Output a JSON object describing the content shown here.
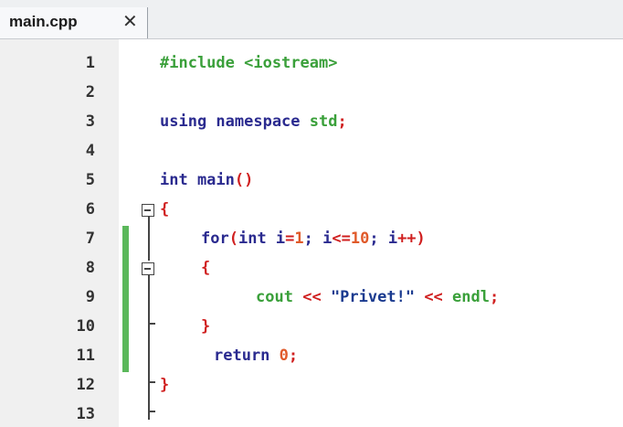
{
  "tab": {
    "filename": "main.cpp",
    "close_symbol": "✕"
  },
  "line_numbers": [
    "1",
    "2",
    "3",
    "4",
    "5",
    "6",
    "7",
    "8",
    "9",
    "10",
    "11",
    "12",
    "13"
  ],
  "code": {
    "l1_include": "#include <iostream>",
    "l3_using": "using namespace",
    "l3_std": "std",
    "l3_semi": ";",
    "l5_int": "int main",
    "l5_parens": "()",
    "l6_brace": "{",
    "l7_for": "for",
    "l7_open": "(",
    "l7_int": "int i",
    "l7_eq": "=",
    "l7_one": "1",
    "l7_semi1": "; i",
    "l7_le": "<=",
    "l7_ten": "10",
    "l7_semi2": "; i",
    "l7_pp": "++",
    "l7_close": ")",
    "l8_brace": "{",
    "l9_cout": "cout",
    "l9_shl1": "<<",
    "l9_str": "\"Privet!\"",
    "l9_shl2": "<<",
    "l9_endl": "endl",
    "l9_semi": ";",
    "l10_brace": "}",
    "l11_return": "return",
    "l11_zero": "0",
    "l11_semi": ";",
    "l12_brace": "}"
  },
  "colors": {
    "keyword": "#2a2a8f",
    "preprocessor": "#3aa03a",
    "number": "#e05a2a",
    "operator": "#d02020",
    "change_marker": "#5bb85b"
  }
}
